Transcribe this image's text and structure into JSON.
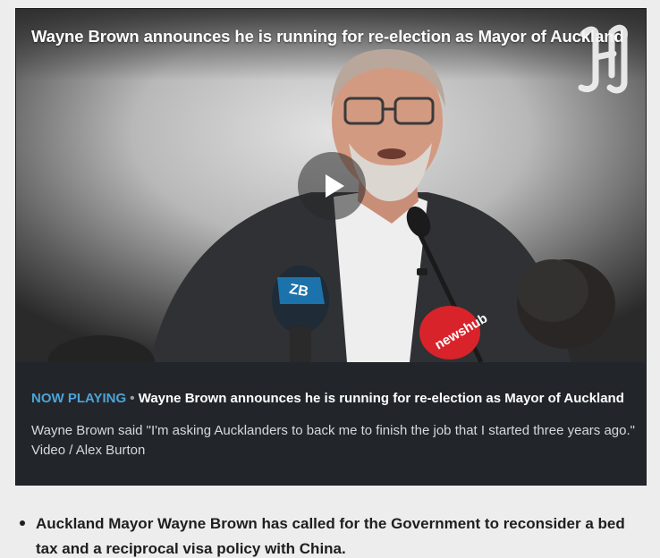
{
  "video": {
    "title": "Wayne Brown announces he is running for re-election as Mayor of Auckland",
    "logo_icon": "herald-h-logo",
    "play_icon": "play-icon",
    "now_playing_label": "NOW PLAYING",
    "separator": "•",
    "now_playing_title": "Wayne Brown announces he is running for re-election as Mayor of Auckland",
    "caption": "Wayne Brown said \"I'm asking Aucklanders to back me to finish the job that I started three years ago.\" Video / Alex Burton",
    "mic_logos": [
      "ZB",
      "newshub"
    ]
  },
  "article": {
    "bullets": [
      "Auckland Mayor Wayne Brown has called for the Government to reconsider a bed tax and a reciprocal visa policy with China."
    ]
  },
  "colors": {
    "accent": "#4da3d8",
    "card_background": "#22262a",
    "page_background": "#ededed"
  }
}
